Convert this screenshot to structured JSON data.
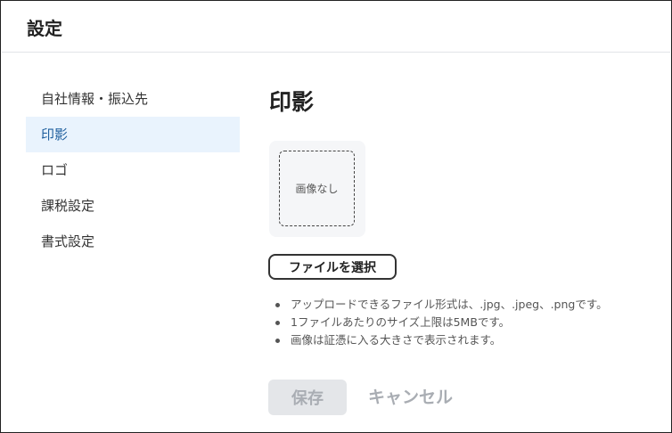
{
  "header": {
    "title": "設定"
  },
  "sidebar": {
    "items": [
      {
        "label": "自社情報・振込先",
        "active": false
      },
      {
        "label": "印影",
        "active": true
      },
      {
        "label": "ロゴ",
        "active": false
      },
      {
        "label": "課税設定",
        "active": false
      },
      {
        "label": "書式設定",
        "active": false
      }
    ]
  },
  "main": {
    "title": "印影",
    "preview": {
      "empty_label": "画像なし"
    },
    "file_button_label": "ファイルを選択",
    "notes": [
      "アップロードできるファイル形式は、.jpg、.jpeg、.pngです。",
      "1ファイルあたりのサイズ上限は5MBです。",
      "画像は証憑に入る大きさで表示されます。"
    ],
    "save_label": "保存",
    "cancel_label": "キャンセル"
  },
  "colors": {
    "active_item_bg": "#e9f3fd",
    "active_item_text": "#1f5f9e",
    "disabled_text": "#a9adb3",
    "disabled_bg": "#e4e6e9"
  }
}
